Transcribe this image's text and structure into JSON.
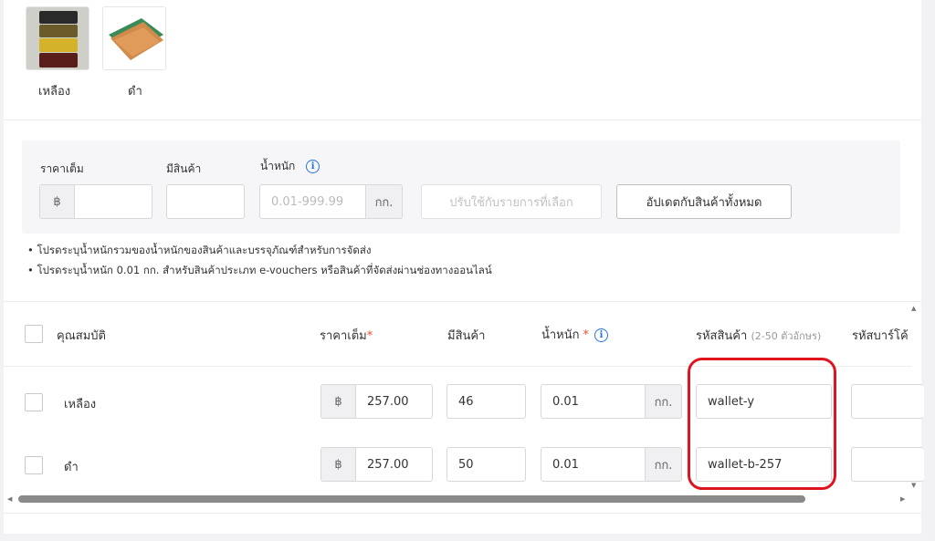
{
  "variations": [
    {
      "label": "เหลือง"
    },
    {
      "label": "ดำ"
    }
  ],
  "bulk": {
    "price_label": "ราคาเต็ม",
    "stock_label": "มีสินค้า",
    "weight_label": "น้ำหนัก",
    "currency": "฿",
    "weight_placeholder": "0.01-999.99",
    "weight_unit": "กก.",
    "apply_selected": "ปรับใช้กับรายการที่เลือก",
    "update_all": "อัปเดตกับสินค้าทั้งหมด"
  },
  "notes": [
    "โปรดระบุน้ำหนักรวมของน้ำหนักของสินค้าและบรรจุภัณฑ์สำหรับการจัดส่ง",
    "โปรดระบุน้ำหนัก 0.01 กก. สำหรับสินค้าประเภท e-vouchers หรือสินค้าที่จัดส่งผ่านช่องทางออนไลน์"
  ],
  "table": {
    "headers": {
      "attribute": "คุณสมบัติ",
      "price": "ราคาเต็ม",
      "stock": "มีสินค้า",
      "weight": "น้ำหนัก",
      "sku": "รหัสสินค้า",
      "sku_hint": "(2-50 ตัวอักษร)",
      "barcode": "รหัสบาร์โค้"
    },
    "required_mark": "*",
    "rows": [
      {
        "name": "เหลือง",
        "currency": "฿",
        "price": "257.00",
        "stock": "46",
        "weight": "0.01",
        "unit": "กก.",
        "sku": "wallet-y"
      },
      {
        "name": "ดำ",
        "currency": "฿",
        "price": "257.00",
        "stock": "50",
        "weight": "0.01",
        "unit": "กก.",
        "sku": "wallet-b-257"
      }
    ]
  },
  "colors": {
    "highlight": "#e0141e",
    "info": "#2673dd",
    "required": "#ee4d2d"
  }
}
